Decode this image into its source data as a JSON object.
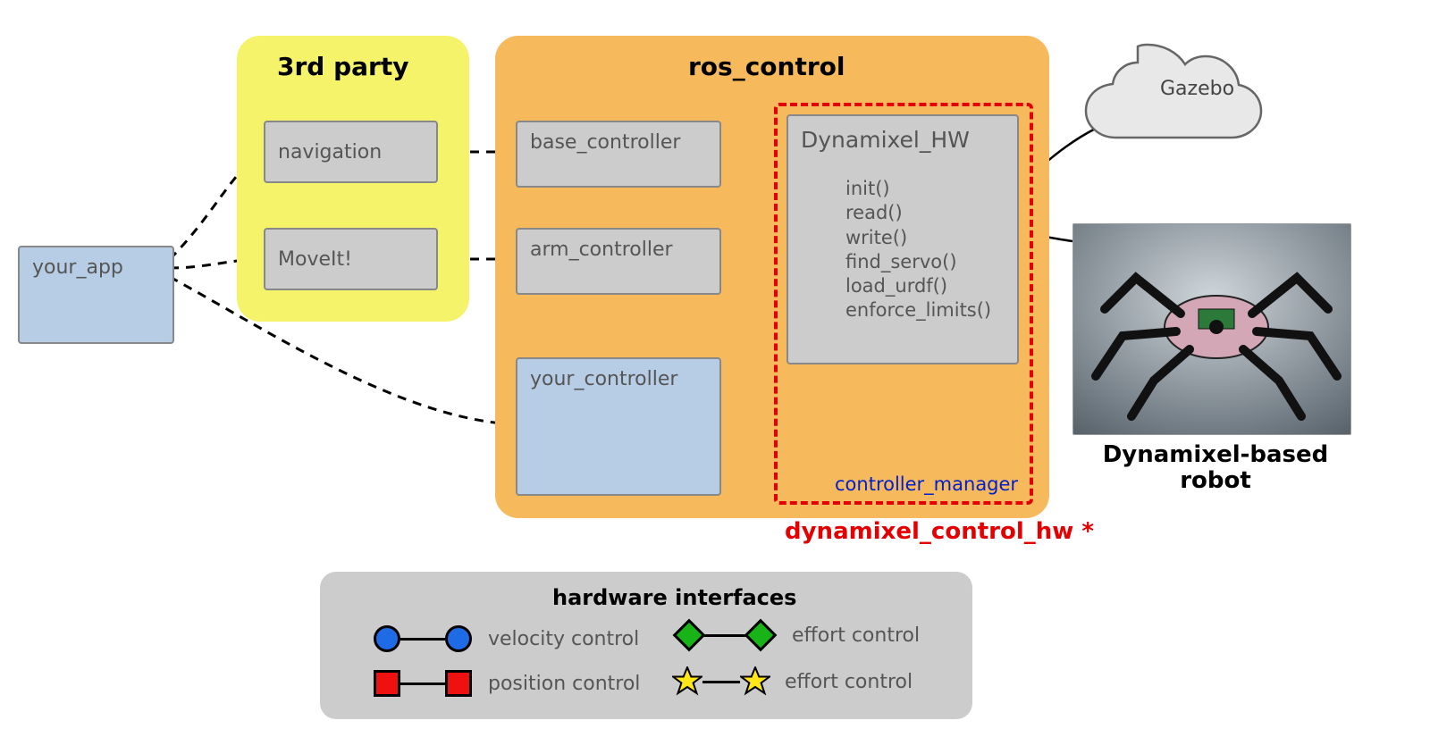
{
  "titles": {
    "third_party": "3rd party",
    "ros_control": "ros_control",
    "dyn_hw_label": "dynamixel_control_hw *",
    "robot_label_line1": "Dynamixel-based",
    "robot_label_line2": "robot",
    "ctrl_manager": "controller_manager"
  },
  "nodes": {
    "your_app": "your_app",
    "navigation": "navigation",
    "moveit": "MoveIt!",
    "base_controller": "base_controller",
    "arm_controller": "arm_controller",
    "your_controller": "your_controller",
    "dynamixel_hw": "Dynamixel_HW",
    "gazebo": "Gazebo"
  },
  "hw_methods": [
    "init()",
    "read()",
    "write()",
    "find_servo()",
    "load_urdf()",
    "enforce_limits()"
  ],
  "legend": {
    "title": "hardware interfaces",
    "velocity": "velocity control",
    "position": "position control",
    "effort1": "effort control",
    "effort2": "effort control"
  }
}
